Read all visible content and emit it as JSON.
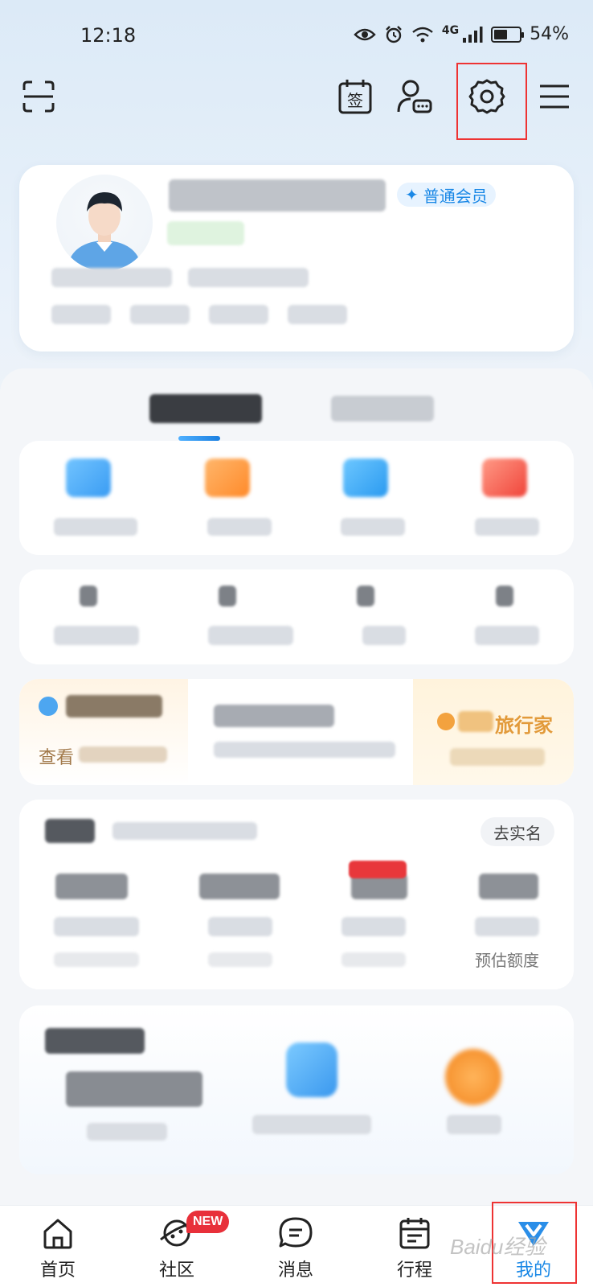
{
  "status_bar": {
    "time": "12:18",
    "network": "4G",
    "battery_percent_text": "54%",
    "battery_level": 0.54
  },
  "toolbar": {
    "icons": [
      "scan-icon",
      "sign-in-calendar-icon",
      "customer-service-icon",
      "gear-icon",
      "menu-icon"
    ],
    "sign_in_glyph": "签"
  },
  "profile": {
    "vip_label": "普通会员"
  },
  "tabs": {
    "active_index": 0
  },
  "tags_card": {
    "real_name": "去实名",
    "credit_hint": "预估额度"
  },
  "promo": {
    "link_prefix": "查看",
    "traveler_label": "旅行家"
  },
  "bottom_nav": {
    "items": [
      {
        "label": "首页",
        "icon": "home-icon"
      },
      {
        "label": "社区",
        "icon": "community-planet-icon",
        "badge": "NEW"
      },
      {
        "label": "消息",
        "icon": "message-icon"
      },
      {
        "label": "行程",
        "icon": "calendar-itinerary-icon"
      },
      {
        "label": "我的",
        "icon": "my-profile-icon",
        "active": true
      }
    ],
    "active_color": "#1a88e6"
  },
  "watermark": "Baidu经验",
  "colors": {
    "accent": "#1a88e6",
    "highlight_box": "#ee3333",
    "new_badge": "#e8303a"
  }
}
